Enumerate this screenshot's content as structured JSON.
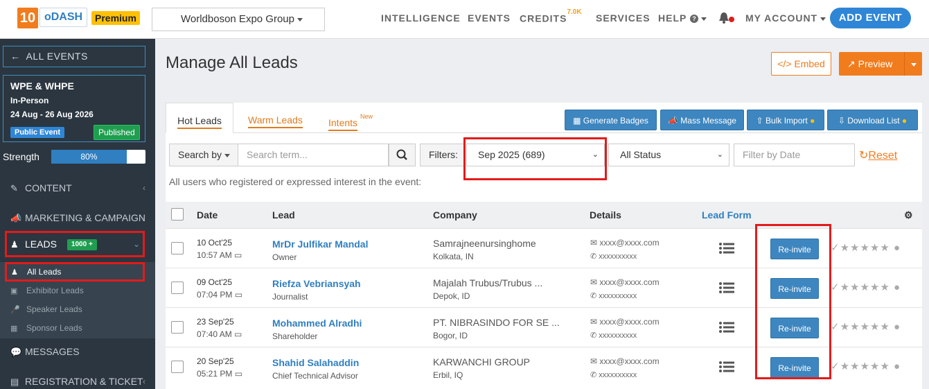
{
  "topbar": {
    "logo_num": "10",
    "logo_name": "oDASH",
    "premium": "Premium",
    "org": "Worldboson Expo Group",
    "nav": {
      "intelligence": "INTELLIGENCE",
      "events": "EVENTS",
      "credits": "CREDITS",
      "credits_count": "7.0K",
      "services": "SERVICES",
      "help": "HELP",
      "account": "MY ACCOUNT"
    },
    "add_event": "ADD EVENT"
  },
  "sidebar": {
    "all_events": "ALL EVENTS",
    "event_title": "WPE & WHPE",
    "event_type": "In-Person",
    "event_dates": "24 Aug - 26 Aug 2026",
    "public_event": "Public Event",
    "published": "Published",
    "strength_label": "Strength",
    "strength_value": 0.8,
    "strength_text": "80%",
    "content": "CONTENT",
    "marketing": "MARKETING & CAMPAIGN",
    "leads": "LEADS",
    "leads_badge": "1000 +",
    "sub": [
      "All Leads",
      "Exhibitor Leads",
      "Speaker Leads",
      "Sponsor Leads"
    ],
    "messages": "MESSAGES",
    "registration": "REGISTRATION & TICKET"
  },
  "main": {
    "title": "Manage All Leads",
    "embed": "Embed",
    "preview": "Preview",
    "tabs": {
      "hot": "Hot Leads",
      "warm": "Warm Leads",
      "intents": "Intents",
      "intents_badge": "New"
    },
    "actions": {
      "badges": "Generate Badges",
      "mass": "Mass Message",
      "bulk": "Bulk Import",
      "download": "Download List"
    },
    "search_by": "Search by",
    "search_placeholder": "Search term...",
    "filters_label": "Filters:",
    "filter_month": "Sep 2025 (689)",
    "filter_status": "All Status",
    "date_placeholder": "Filter by Date",
    "reset": "Reset",
    "hint": "All users who registered or expressed interest in the event:",
    "columns": {
      "date": "Date",
      "lead": "Lead",
      "company": "Company",
      "details": "Details",
      "lead_form": "Lead Form"
    },
    "reinvite": "Re-invite",
    "rows": [
      {
        "date": "10 Oct'25",
        "time": "10:57 AM",
        "name": "MrDr Julfikar Mandal",
        "role": "Owner",
        "company": "Samrajneenursinghome",
        "location": "Kolkata, IN",
        "email": "xxxx@xxxx.com",
        "phone": "xxxxxxxxxx"
      },
      {
        "date": "09 Oct'25",
        "time": "07:04 PM",
        "name": "Riefza Vebriansyah",
        "role": "Journalist",
        "company": "Majalah Trubus/Trubus ...",
        "location": "Depok, ID",
        "email": "xxxx@xxxx.com",
        "phone": "xxxxxxxxxx"
      },
      {
        "date": "23 Sep'25",
        "time": "07:40 AM",
        "name": "Mohammed Alradhi",
        "role": "Shareholder",
        "company": "PT. NIBRASINDO FOR SE ...",
        "location": "Bogor, ID",
        "email": "xxxx@xxxx.com",
        "phone": "xxxxxxxxxx"
      },
      {
        "date": "20 Sep'25",
        "time": "05:21 PM",
        "name": "Shahid Salahaddin",
        "role": "Chief Technical Advisor",
        "company": "KARWANCHI GROUP",
        "location": "Erbil, IQ",
        "email": "xxxx@xxxx.com",
        "phone": "xxxxxxxxxx"
      }
    ]
  }
}
